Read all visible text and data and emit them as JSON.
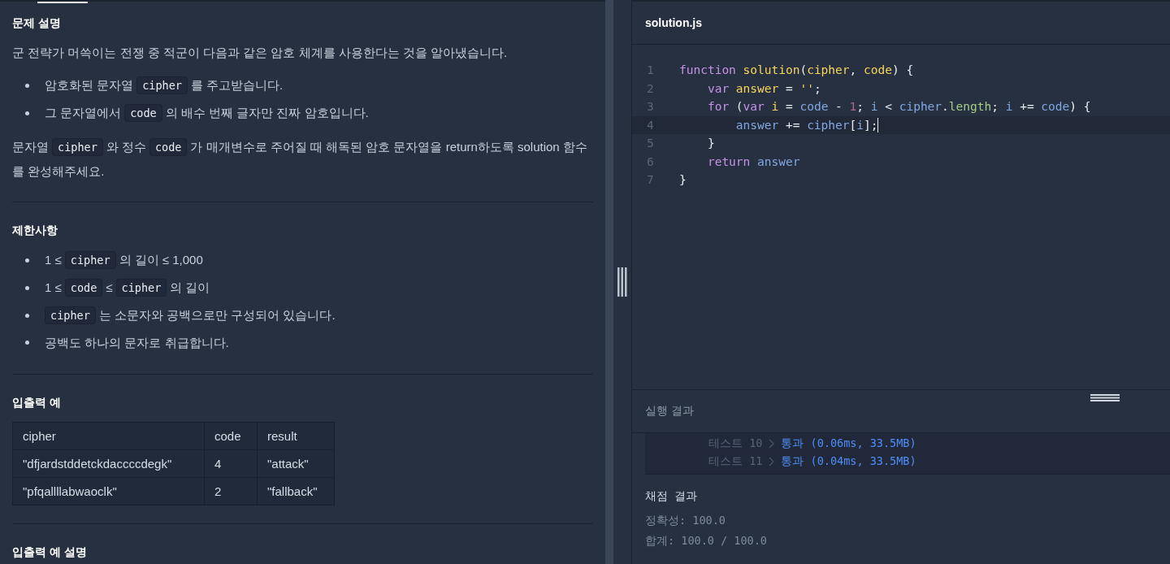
{
  "problem": {
    "sections": [
      {
        "title": "문제 설명",
        "blocks": [
          {
            "kind": "paragraph",
            "segments": [
              {
                "kind": "text",
                "text": "군 전략가 머쓱이는 전쟁 중 적군이 다음과 같은 암호 체계를 사용한다는 것을 알아냈습니다."
              }
            ]
          },
          {
            "kind": "bullets",
            "items": [
              [
                {
                  "kind": "text",
                  "text": "암호화된 문자열"
                },
                {
                  "kind": "code",
                  "text": "cipher"
                },
                {
                  "kind": "text",
                  "text": "를 주고받습니다."
                }
              ],
              [
                {
                  "kind": "text",
                  "text": "그 문자열에서"
                },
                {
                  "kind": "code",
                  "text": "code"
                },
                {
                  "kind": "text",
                  "text": "의 배수 번째 글자만 진짜 암호입니다."
                }
              ]
            ]
          },
          {
            "kind": "paragraph",
            "segments": [
              {
                "kind": "text",
                "text": "문자열"
              },
              {
                "kind": "code",
                "text": "cipher"
              },
              {
                "kind": "text",
                "text": "와 정수"
              },
              {
                "kind": "code",
                "text": "code"
              },
              {
                "kind": "text",
                "text": "가 매개변수로 주어질 때 해독된 암호 문자열을 return하도록 solution 함수"
              },
              {
                "kind": "text",
                "text": "를 완성해주세요."
              }
            ]
          }
        ]
      },
      {
        "title": "제한사항",
        "blocks": [
          {
            "kind": "bullets",
            "items": [
              [
                {
                  "kind": "text",
                  "text": "1 ≤"
                },
                {
                  "kind": "code",
                  "text": "cipher"
                },
                {
                  "kind": "text",
                  "text": "의 길이 ≤ 1,000"
                }
              ],
              [
                {
                  "kind": "text",
                  "text": "1 ≤"
                },
                {
                  "kind": "code",
                  "text": "code"
                },
                {
                  "kind": "text",
                  "text": "≤"
                },
                {
                  "kind": "code",
                  "text": "cipher"
                },
                {
                  "kind": "text",
                  "text": "의 길이"
                }
              ],
              [
                {
                  "kind": "code",
                  "text": "cipher"
                },
                {
                  "kind": "text",
                  "text": "는 소문자와 공백으로만 구성되어 있습니다."
                }
              ],
              [
                {
                  "kind": "text",
                  "text": "공백도 하나의 문자로 취급합니다."
                }
              ]
            ]
          }
        ]
      },
      {
        "title": "입출력 예",
        "blocks": [
          {
            "kind": "table",
            "columns": [
              "cipher",
              "code",
              "result"
            ],
            "rows": [
              [
                "\"dfjardstddetckdaccccdegk\"",
                "4",
                "\"attack\""
              ],
              [
                "\"pfqallllabwaoclk\"",
                "2",
                "\"fallback\""
              ]
            ]
          }
        ]
      },
      {
        "title": "입출력 예 설명"
      }
    ]
  },
  "editor": {
    "filename": "solution.js",
    "lines": [
      {
        "number": "1",
        "current": false,
        "tokens": [
          {
            "kind": "keyword",
            "text": "function "
          },
          {
            "kind": "def",
            "text": "solution"
          },
          {
            "kind": "punct",
            "text": "("
          },
          {
            "kind": "def",
            "text": "cipher"
          },
          {
            "kind": "punct",
            "text": ", "
          },
          {
            "kind": "def",
            "text": "code"
          },
          {
            "kind": "punct",
            "text": ") {"
          }
        ]
      },
      {
        "number": "2",
        "current": false,
        "tokens": [
          {
            "kind": "keyword",
            "text": "    var "
          },
          {
            "kind": "def",
            "text": "answer"
          },
          {
            "kind": "punct",
            "text": " = "
          },
          {
            "kind": "string",
            "text": "''"
          },
          {
            "kind": "punct",
            "text": ";"
          }
        ]
      },
      {
        "number": "3",
        "current": false,
        "tokens": [
          {
            "kind": "keyword",
            "text": "    for "
          },
          {
            "kind": "punct",
            "text": "("
          },
          {
            "kind": "keyword",
            "text": "var "
          },
          {
            "kind": "def",
            "text": "i"
          },
          {
            "kind": "punct",
            "text": " = "
          },
          {
            "kind": "variable",
            "text": "code"
          },
          {
            "kind": "punct",
            "text": " - "
          },
          {
            "kind": "number",
            "text": "1"
          },
          {
            "kind": "punct",
            "text": "; "
          },
          {
            "kind": "variable",
            "text": "i"
          },
          {
            "kind": "punct",
            "text": " < "
          },
          {
            "kind": "variable",
            "text": "cipher"
          },
          {
            "kind": "punct",
            "text": "."
          },
          {
            "kind": "property",
            "text": "length"
          },
          {
            "kind": "punct",
            "text": "; "
          },
          {
            "kind": "variable",
            "text": "i"
          },
          {
            "kind": "punct",
            "text": " += "
          },
          {
            "kind": "variable",
            "text": "code"
          },
          {
            "kind": "punct",
            "text": ") {"
          }
        ]
      },
      {
        "number": "4",
        "current": true,
        "tokens": [
          {
            "kind": "variable",
            "text": "        answer"
          },
          {
            "kind": "punct",
            "text": " += "
          },
          {
            "kind": "variable",
            "text": "cipher"
          },
          {
            "kind": "punct",
            "text": "["
          },
          {
            "kind": "variable",
            "text": "i"
          },
          {
            "kind": "punct",
            "text": "];"
          }
        ]
      },
      {
        "number": "5",
        "current": false,
        "tokens": [
          {
            "kind": "punct",
            "text": "    }"
          }
        ]
      },
      {
        "number": "6",
        "current": false,
        "tokens": [
          {
            "kind": "keyword",
            "text": "    return "
          },
          {
            "kind": "variable",
            "text": "answer"
          }
        ]
      },
      {
        "number": "7",
        "current": false,
        "tokens": [
          {
            "kind": "punct",
            "text": "}"
          }
        ]
      }
    ]
  },
  "results": {
    "title": "실행 결과",
    "tests": [
      {
        "label": "테스트 10",
        "result": "통과 (0.06ms, 33.5MB)"
      },
      {
        "label": "테스트 11",
        "result": "통과 (0.04ms, 33.5MB)"
      }
    ],
    "grading": {
      "title": "채점 결과",
      "lines": [
        "정확성: 100.0",
        "합계: 100.0 / 100.0"
      ]
    }
  }
}
